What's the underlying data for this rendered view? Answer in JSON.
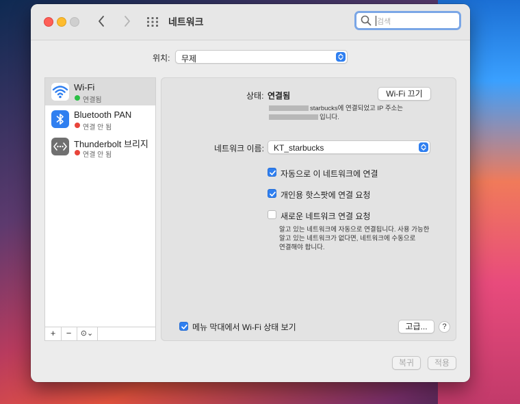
{
  "window": {
    "title": "네트워크",
    "search": {
      "placeholder": "검색"
    }
  },
  "location": {
    "label": "위치:",
    "value": "무제"
  },
  "services": [
    {
      "name": "Wi-Fi",
      "status": "연결됨",
      "status_color": "#2bbf45"
    },
    {
      "name": "Bluetooth PAN",
      "status": "연결 안 됨",
      "status_color": "#e8443a"
    },
    {
      "name": "Thunderbolt 브리지",
      "status": "연결 안 됨",
      "status_color": "#e8443a"
    }
  ],
  "sidebar_tools": {
    "add": "+",
    "remove": "−",
    "more": "⊙⌄"
  },
  "panel": {
    "status_label": "상태:",
    "status_value": "연결됨",
    "wifi_off_button": "Wi-Fi 끄기",
    "status_desc_line1": "starbucks에 연결되었고 IP 주소는",
    "status_desc_line2": "입니다.",
    "network_name_label": "네트워크 이름:",
    "network_name_value": "KT_starbucks",
    "auto_join_label": "자동으로 이 네트워크에 연결",
    "auto_join_checked": true,
    "hotspot_label": "개인용 핫스팟에 연결 요청",
    "hotspot_checked": true,
    "ask_new_label": "새로운 네트워크 연결 요청",
    "ask_new_checked": false,
    "ask_new_desc_1": "알고 있는 네트워크에 자동으로 연결됩니다. 사용 가능한",
    "ask_new_desc_2": "알고 있는 네트워크가 없다면, 네트워크에 수동으로",
    "ask_new_desc_3": "연결해야 합니다.",
    "menu_bar_label": "메뉴 막대에서 Wi-Fi 상태 보기",
    "menu_bar_checked": true,
    "advanced_button": "고급...",
    "help_button": "?"
  },
  "footer": {
    "revert_button": "복귀",
    "apply_button": "적용"
  },
  "colors": {
    "accent": "#2f7ff0",
    "search_focus": "#7aa6e6"
  }
}
